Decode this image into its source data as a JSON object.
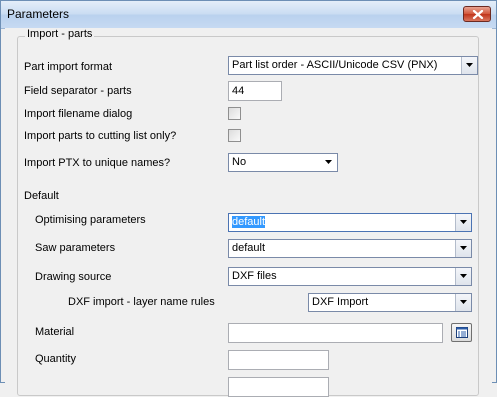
{
  "window": {
    "title": "Parameters"
  },
  "group": {
    "caption": "Import - parts"
  },
  "fields": {
    "part_import_format": {
      "label": "Part import format",
      "value": "Part list order - ASCII/Unicode CSV (PNX)"
    },
    "field_separator": {
      "label": "Field separator - parts",
      "value": "44"
    },
    "import_filename_dialog": {
      "label": "Import filename dialog",
      "checked": false
    },
    "import_to_cutting_list": {
      "label": "Import parts to cutting list only?",
      "checked": false
    },
    "import_ptx_unique": {
      "label": "Import PTX to unique names?",
      "value": "No"
    }
  },
  "default_section": {
    "heading": "Default",
    "optimising_parameters": {
      "label": "Optimising parameters",
      "value": "default"
    },
    "saw_parameters": {
      "label": "Saw parameters",
      "value": "default"
    },
    "drawing_source": {
      "label": "Drawing source",
      "value": "DXF files"
    },
    "dxf_layer_rules": {
      "label": "DXF import - layer name rules",
      "value": "DXF Import"
    },
    "material": {
      "label": "Material",
      "value": ""
    },
    "quantity": {
      "label": "Quantity",
      "value": ""
    }
  },
  "icons": {
    "close": "close-icon",
    "dropdown_arrow": "chevron-down-icon",
    "browse": "list-browse-icon"
  }
}
